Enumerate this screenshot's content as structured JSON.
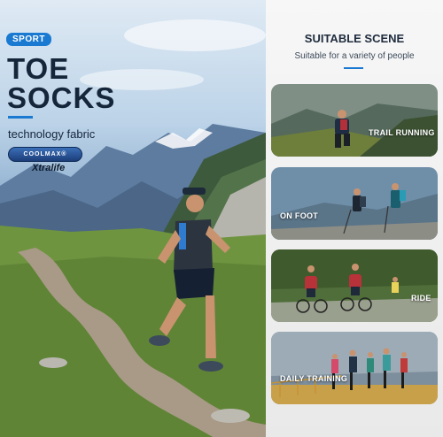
{
  "hero": {
    "tag": "SPORT",
    "title_line1": "TOE",
    "title_line2": "SOCKS",
    "subtitle": "technology fabric",
    "logo_coolmax": "COOLMAX®",
    "logo_xtralife": "Xtralife"
  },
  "scenes": {
    "title": "SUITABLE SCENE",
    "subtitle": "Suitable for a variety of people",
    "items": [
      {
        "label": "TRAIL RUNNING"
      },
      {
        "label": "ON FOOT"
      },
      {
        "label": "RIDE"
      },
      {
        "label": "DAILY TRAINING"
      }
    ]
  },
  "colors": {
    "accent": "#1a7ad2",
    "title_dark": "#15263b"
  }
}
